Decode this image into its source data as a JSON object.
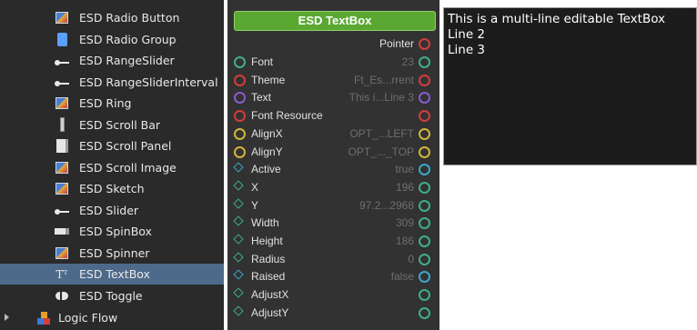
{
  "tree": {
    "items": [
      {
        "label": "ESD Radio Button",
        "icon": "image-icon"
      },
      {
        "label": "ESD Radio Group",
        "icon": "radio-group-icon"
      },
      {
        "label": "ESD RangeSlider",
        "icon": "slider-icon"
      },
      {
        "label": "ESD RangeSliderInterval",
        "icon": "slider-icon"
      },
      {
        "label": "ESD Ring",
        "icon": "image-icon"
      },
      {
        "label": "ESD Scroll Bar",
        "icon": "scrollbar-icon"
      },
      {
        "label": "ESD Scroll Panel",
        "icon": "scroll-panel-icon"
      },
      {
        "label": "ESD Scroll Image",
        "icon": "image-icon"
      },
      {
        "label": "ESD Sketch",
        "icon": "image-icon"
      },
      {
        "label": "ESD Slider",
        "icon": "slider-icon"
      },
      {
        "label": "ESD SpinBox",
        "icon": "spinbox-icon"
      },
      {
        "label": "ESD Spinner",
        "icon": "image-icon"
      },
      {
        "label": "ESD TextBox",
        "icon": "textbox-icon",
        "selected": true
      },
      {
        "label": "ESD Toggle",
        "icon": "toggle-icon"
      }
    ],
    "logic_flow": {
      "label": "Logic Flow",
      "icon": "logic-flow-icon"
    },
    "textbox_glyph": "Tᵀ",
    "colors": {
      "background": "#2a2a2a",
      "selected": "#4e6a8a"
    }
  },
  "node": {
    "title": "ESD TextBox",
    "pointer_label": "Pointer",
    "rows": [
      {
        "name": "Font",
        "value": "23",
        "pin": "circle",
        "left_color": "#3fae8a",
        "right_color": "#3fae8a"
      },
      {
        "name": "Theme",
        "value": "Ft_Es...rrent",
        "pin": "circle",
        "left_color": "#d23c3c",
        "right_color": "#d23c3c"
      },
      {
        "name": "Text",
        "value": "This i...Line 3",
        "pin": "circle",
        "left_color": "#8a5ad0",
        "right_color": "#8a5ad0"
      },
      {
        "name": "Font Resource",
        "value": "",
        "pin": "circle",
        "left_color": "#d23c3c",
        "right_color": "#d23c3c"
      },
      {
        "name": "AlignX",
        "value": "OPT_...LEFT",
        "pin": "circle",
        "left_color": "#d2b43c",
        "right_color": "#d2b43c"
      },
      {
        "name": "AlignY",
        "value": "OPT_..._TOP",
        "pin": "circle",
        "left_color": "#d2b43c",
        "right_color": "#d2b43c"
      },
      {
        "name": "Active",
        "value": "true",
        "pin": "diamond",
        "left_color": "#3ca8c8",
        "right_color": "#3ca8c8"
      },
      {
        "name": "X",
        "value": "196",
        "pin": "diamond",
        "left_color": "#3fae8a",
        "right_color": "#3fae8a"
      },
      {
        "name": "Y",
        "value": "97.2...2968",
        "pin": "diamond",
        "left_color": "#3fae8a",
        "right_color": "#3fae8a"
      },
      {
        "name": "Width",
        "value": "309",
        "pin": "diamond",
        "left_color": "#3fae8a",
        "right_color": "#3fae8a"
      },
      {
        "name": "Height",
        "value": "186",
        "pin": "diamond",
        "left_color": "#3fae8a",
        "right_color": "#3fae8a"
      },
      {
        "name": "Radius",
        "value": "0",
        "pin": "diamond",
        "left_color": "#3fae8a",
        "right_color": "#3fae8a"
      },
      {
        "name": "Raised",
        "value": "false",
        "pin": "diamond",
        "left_color": "#3ca8c8",
        "right_color": "#3ca8c8"
      },
      {
        "name": "AdjustX",
        "value": "",
        "pin": "diamond",
        "left_color": "#3fae8a",
        "right_color": "#3fae8a"
      },
      {
        "name": "AdjustY",
        "value": "",
        "pin": "diamond",
        "left_color": "#3fae8a",
        "right_color": "#3fae8a"
      }
    ],
    "colors": {
      "header": "#5aa832",
      "panel": "#323232",
      "pointer_pin": "#d23c3c"
    }
  },
  "preview": {
    "lines": [
      "This is a multi-line editable TextBox",
      "Line 2",
      "Line 3"
    ]
  }
}
